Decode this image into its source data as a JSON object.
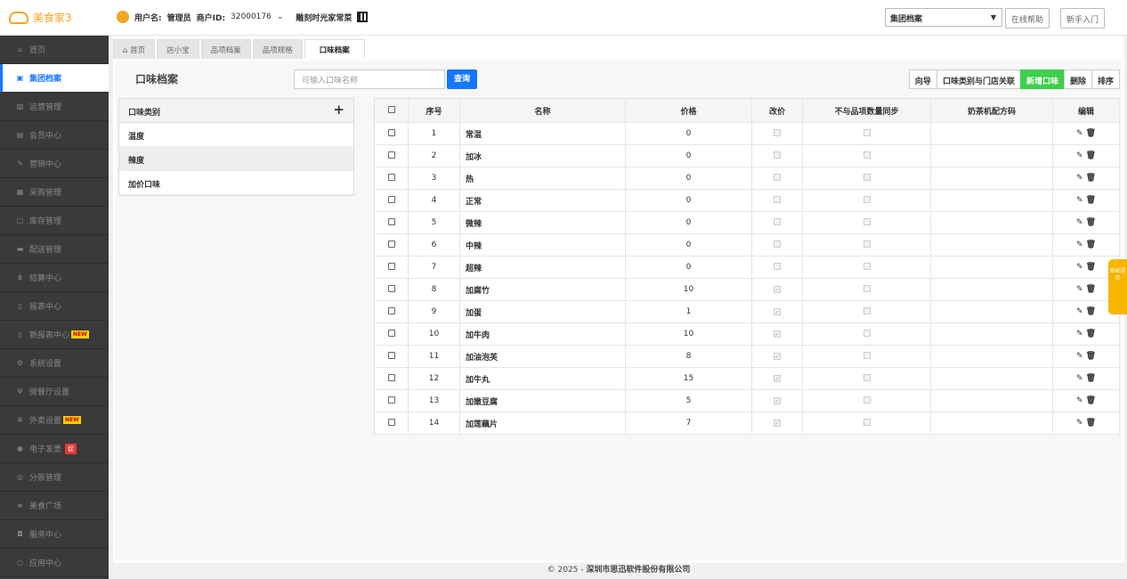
{
  "header": {
    "app_name": "美食家3",
    "user_label": "用户名:",
    "user_value": "管理员",
    "merchant_label": "商户ID:",
    "merchant_id": "32000176",
    "store_name": "雕刻时光家常菜",
    "group_select": "集团档案",
    "help_btn": "在线帮助",
    "newbie_btn": "新手入门"
  },
  "sidebar": {
    "items": [
      {
        "label": "首页",
        "icon": "home-icon"
      },
      {
        "label": "集团档案",
        "icon": "doc-icon"
      },
      {
        "label": "运营管理",
        "icon": "chart-icon"
      },
      {
        "label": "会员中心",
        "icon": "card-icon"
      },
      {
        "label": "营销中心",
        "icon": "edit-icon"
      },
      {
        "label": "采购管理",
        "icon": "cart-icon"
      },
      {
        "label": "库存管理",
        "icon": "box-icon"
      },
      {
        "label": "配送管理",
        "icon": "truck-icon"
      },
      {
        "label": "结算中心",
        "icon": "coin-icon"
      },
      {
        "label": "报表中心",
        "icon": "report-icon"
      },
      {
        "label": "新报表中心",
        "icon": "report-icon",
        "badge": "NEW"
      },
      {
        "label": "系统设置",
        "icon": "gear-icon"
      },
      {
        "label": "微餐厅设置",
        "icon": "fork-icon"
      },
      {
        "label": "外卖设置",
        "icon": "gear-icon",
        "badge": "NEW"
      },
      {
        "label": "电子发票",
        "icon": "invoice-icon",
        "badge": "促"
      },
      {
        "label": "分账管理",
        "icon": "split-icon"
      },
      {
        "label": "美食广场",
        "icon": "shop-icon"
      },
      {
        "label": "服务中心",
        "icon": "service-icon"
      },
      {
        "label": "应用中心",
        "icon": "app-icon"
      }
    ]
  },
  "tabs": [
    "首页",
    "店小宝",
    "品项档案",
    "品项规格",
    "口味档案"
  ],
  "panel": {
    "title": "口味档案",
    "search_placeholder": "可输入口味名称",
    "query_btn": "查询",
    "buttons": [
      "向导",
      "口味类别与门店关联",
      "新增口味",
      "删除",
      "排序"
    ]
  },
  "categories": {
    "header": "口味类别",
    "items": [
      "温度",
      "辣度",
      "加价口味"
    ]
  },
  "table": {
    "headers": [
      "序号",
      "名称",
      "价格",
      "改价",
      "不与品项数量同步",
      "奶茶机配方码",
      "编辑"
    ],
    "rows": [
      {
        "no": "1",
        "name": "常温",
        "price": "0",
        "modprice": false
      },
      {
        "no": "2",
        "name": "加冰",
        "price": "0",
        "modprice": false
      },
      {
        "no": "3",
        "name": "热",
        "price": "0",
        "modprice": false
      },
      {
        "no": "4",
        "name": "正常",
        "price": "0",
        "modprice": false
      },
      {
        "no": "5",
        "name": "微辣",
        "price": "0",
        "modprice": false
      },
      {
        "no": "6",
        "name": "中辣",
        "price": "0",
        "modprice": false
      },
      {
        "no": "7",
        "name": "超辣",
        "price": "0",
        "modprice": false
      },
      {
        "no": "8",
        "name": "加腐竹",
        "price": "10",
        "modprice": true
      },
      {
        "no": "9",
        "name": "加蛋",
        "price": "1",
        "modprice": true
      },
      {
        "no": "10",
        "name": "加牛肉",
        "price": "10",
        "modprice": true
      },
      {
        "no": "11",
        "name": "加油泡芙",
        "price": "8",
        "modprice": true
      },
      {
        "no": "12",
        "name": "加牛丸",
        "price": "15",
        "modprice": true
      },
      {
        "no": "13",
        "name": "加嫩豆腐",
        "price": "5",
        "modprice": true
      },
      {
        "no": "14",
        "name": "加莲藕片",
        "price": "7",
        "modprice": true
      }
    ]
  },
  "footer": {
    "prefix": "© 2025 - ",
    "company": "深圳市思迅软件股份有限公司"
  },
  "side_hint": "系统提示"
}
